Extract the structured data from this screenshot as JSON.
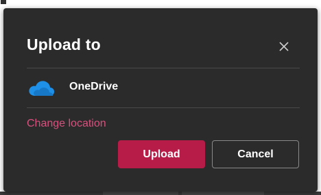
{
  "dialog": {
    "title": "Upload to",
    "close_icon": "close-icon",
    "location": {
      "icon": "onedrive-cloud-icon",
      "label": "OneDrive"
    },
    "change_location_label": "Change location",
    "buttons": {
      "upload_label": "Upload",
      "cancel_label": "Cancel"
    }
  },
  "colors": {
    "dialog_background": "#2b2b2b",
    "primary_button": "#b71c48",
    "link": "#d8517e",
    "onedrive_blue": "#1e90e8"
  }
}
